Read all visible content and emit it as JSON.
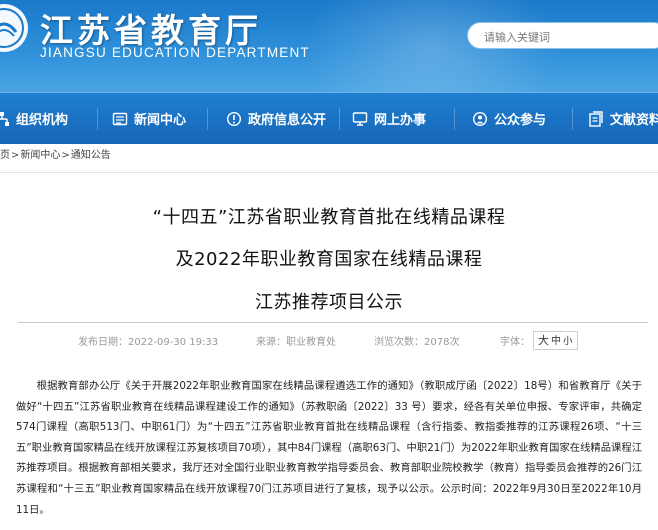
{
  "header": {
    "title": "江苏省教育厅",
    "subtitle": "JIANGSU EDUCATION DEPARTMENT",
    "search_placeholder": "请输入关键词",
    "brand_color": "#1a79c9"
  },
  "nav": {
    "items": [
      {
        "label": "组织机构",
        "icon": "org-chart-icon"
      },
      {
        "label": "新闻中心",
        "icon": "newspaper-icon"
      },
      {
        "label": "政府信息公开",
        "icon": "info-disclosure-icon"
      },
      {
        "label": "网上办事",
        "icon": "monitor-icon"
      },
      {
        "label": "公众参与",
        "icon": "people-icon"
      },
      {
        "label": "文献资料",
        "icon": "documents-icon"
      }
    ]
  },
  "breadcrumb": {
    "items": [
      "页",
      "新闻中心",
      "通知公告"
    ],
    "separator": ">"
  },
  "article": {
    "title_lines": [
      "“十四五”江苏省职业教育首批在线精品课程",
      "及2022年职业教育国家在线精品课程",
      "江苏推荐项目公示"
    ],
    "publish_time": "发布日期：2022-09-30 19:33",
    "source": "来源：职业教育处",
    "views": "浏览次数：2078次",
    "font_label": "字体：",
    "font_sizes": [
      "大",
      "中",
      "小"
    ],
    "body": "根据教育部办公厅《关于开展2022年职业教育国家在线精品课程遴选工作的通知》（教职成厅函〔2022〕18号）和省教育厅《关于做好“十四五”江苏省职业教育在线精品课程建设工作的通知》（苏教职函〔2022〕33 号）要求，经各有关单位申报、专家评审，共确定574门课程（高职513门、中职61门）为“十四五”江苏省职业教育首批在线精品课程（含行指委、教指委推荐的江苏课程26项、“十三五”职业教育国家精品在线开放课程江苏复核项目70项），其中84门课程（高职63门、中职21门）为2022年职业教育国家在线精品课程江苏推荐项目。根据教育部相关要求，我厅还对全国行业职业教育教学指导委员会、教育部职业院校教学（教育）指导委员会推荐的26门江苏课程和“十三五”职业教育国家精品在线开放课程70门江苏项目进行了复核，现予以公示。公示时间：2022年9月30日至2022年10月11日。"
  }
}
